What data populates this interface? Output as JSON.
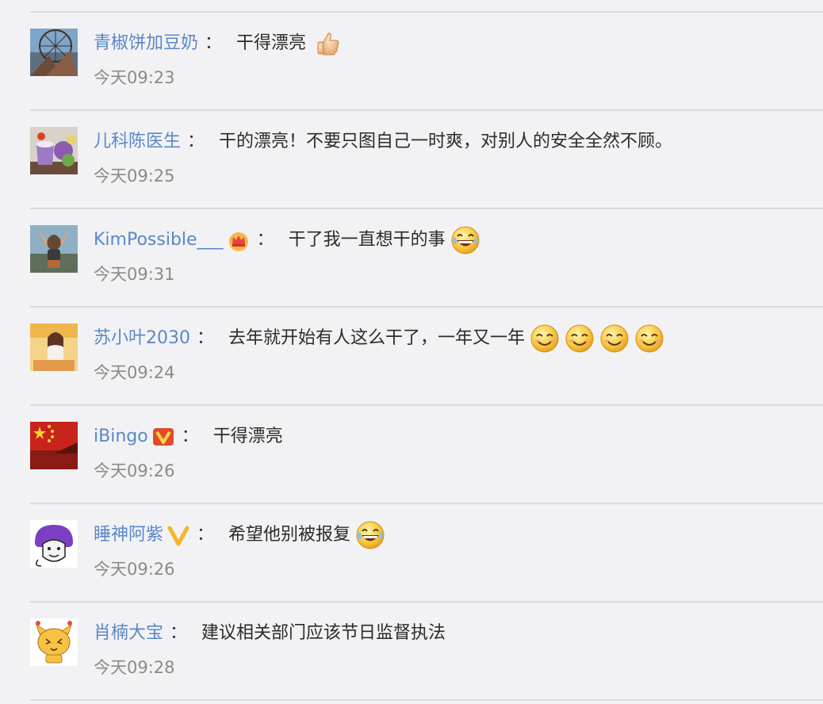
{
  "comments": [
    {
      "username": "青椒饼加豆奶",
      "colon": "：",
      "text": "干得漂亮",
      "time": "今天09:23"
    },
    {
      "username": "儿科陈医生",
      "colon": "：",
      "text": "干的漂亮！不要只图自己一时爽，对别人的安全全然不顾。",
      "time": "今天09:25"
    },
    {
      "username": "KimPossible___",
      "colon": "：",
      "text": "干了我一直想干的事",
      "time": "今天09:31"
    },
    {
      "username": "苏小叶2030",
      "colon": "：",
      "text": "去年就开始有人这么干了，一年又一年",
      "time": "今天09:24"
    },
    {
      "username": "iBingo",
      "colon": "：",
      "text": "干得漂亮",
      "time": "今天09:26"
    },
    {
      "username": "睡神阿紫",
      "colon": "：",
      "text": "希望他别被报复",
      "time": "今天09:26"
    },
    {
      "username": "肖楠大宝",
      "colon": "：",
      "text": "建议相关部门应该节日监督执法",
      "time": "今天09:28"
    }
  ],
  "colors": {
    "username": "#5b87c6",
    "text": "#2b2b2b",
    "time": "#8a8a8a",
    "background": "#f2f2f5",
    "divider": "#d9d9de"
  },
  "icons": {
    "row1_emoji": "thumbs-up-icon",
    "row3_badge": "crown-badge-icon",
    "row3_emoji": "laugh-tears-emoji",
    "row4_emoji": "smile-emoji",
    "row5_badge": "verified-v-red-badge",
    "row6_badge": "verified-v-yellow-badge",
    "row6_emoji": "laugh-tears-emoji"
  }
}
